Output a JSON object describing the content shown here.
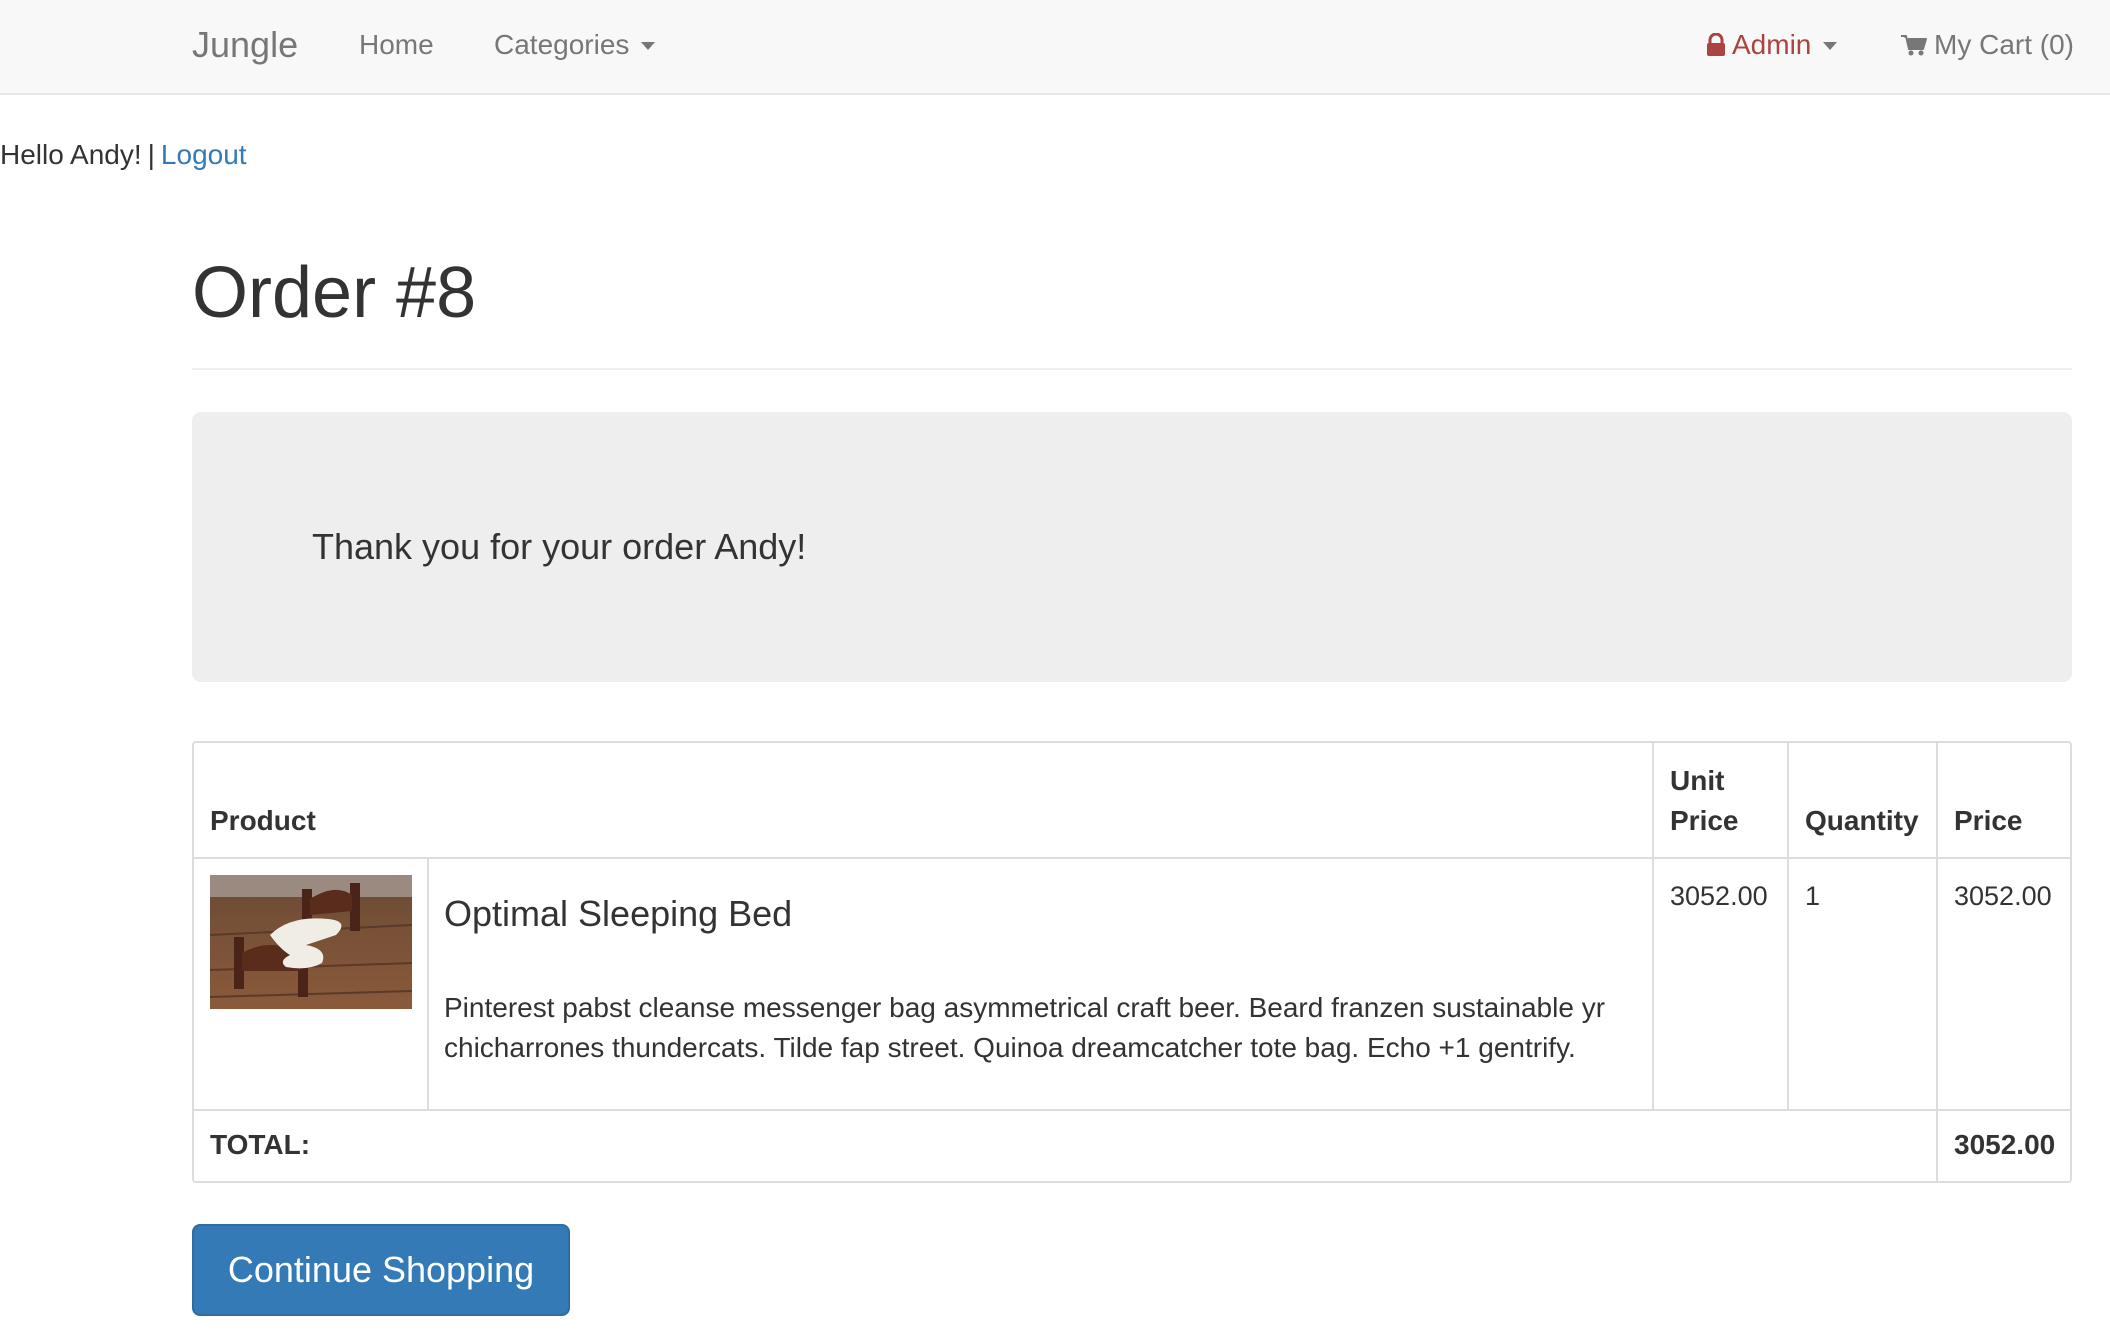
{
  "navbar": {
    "brand": "Jungle",
    "home": "Home",
    "categories": "Categories",
    "admin": "Admin",
    "cart": "My Cart (0)"
  },
  "greeting": {
    "text": "Hello Andy!",
    "separator": "|",
    "logout": "Logout"
  },
  "page": {
    "title": "Order #8",
    "thanks": "Thank you for your order Andy!"
  },
  "table": {
    "headers": {
      "product": "Product",
      "unit_price_line1": "Unit",
      "unit_price_line2": "Price",
      "quantity": "Quantity",
      "price": "Price"
    },
    "rows": [
      {
        "name": "Optimal Sleeping Bed",
        "description": "Pinterest pabst cleanse messenger bag asymmetrical craft beer. Beard franzen sustainable yr chicharrones thundercats. Tilde fap street. Quinoa dreamcatcher tote bag. Echo +1 gentrify.",
        "unit_price": "3052.00",
        "quantity": "1",
        "price": "3052.00"
      }
    ],
    "total_label": "TOTAL:",
    "total_value": "3052.00"
  },
  "actions": {
    "continue_shopping": "Continue Shopping"
  },
  "colors": {
    "link": "#337ab7",
    "admin": "#a94442",
    "button": "#337ab7",
    "jumbotron": "#eeeeee"
  },
  "icons": {
    "admin": "lock-icon",
    "cart": "shopping-cart-icon"
  }
}
